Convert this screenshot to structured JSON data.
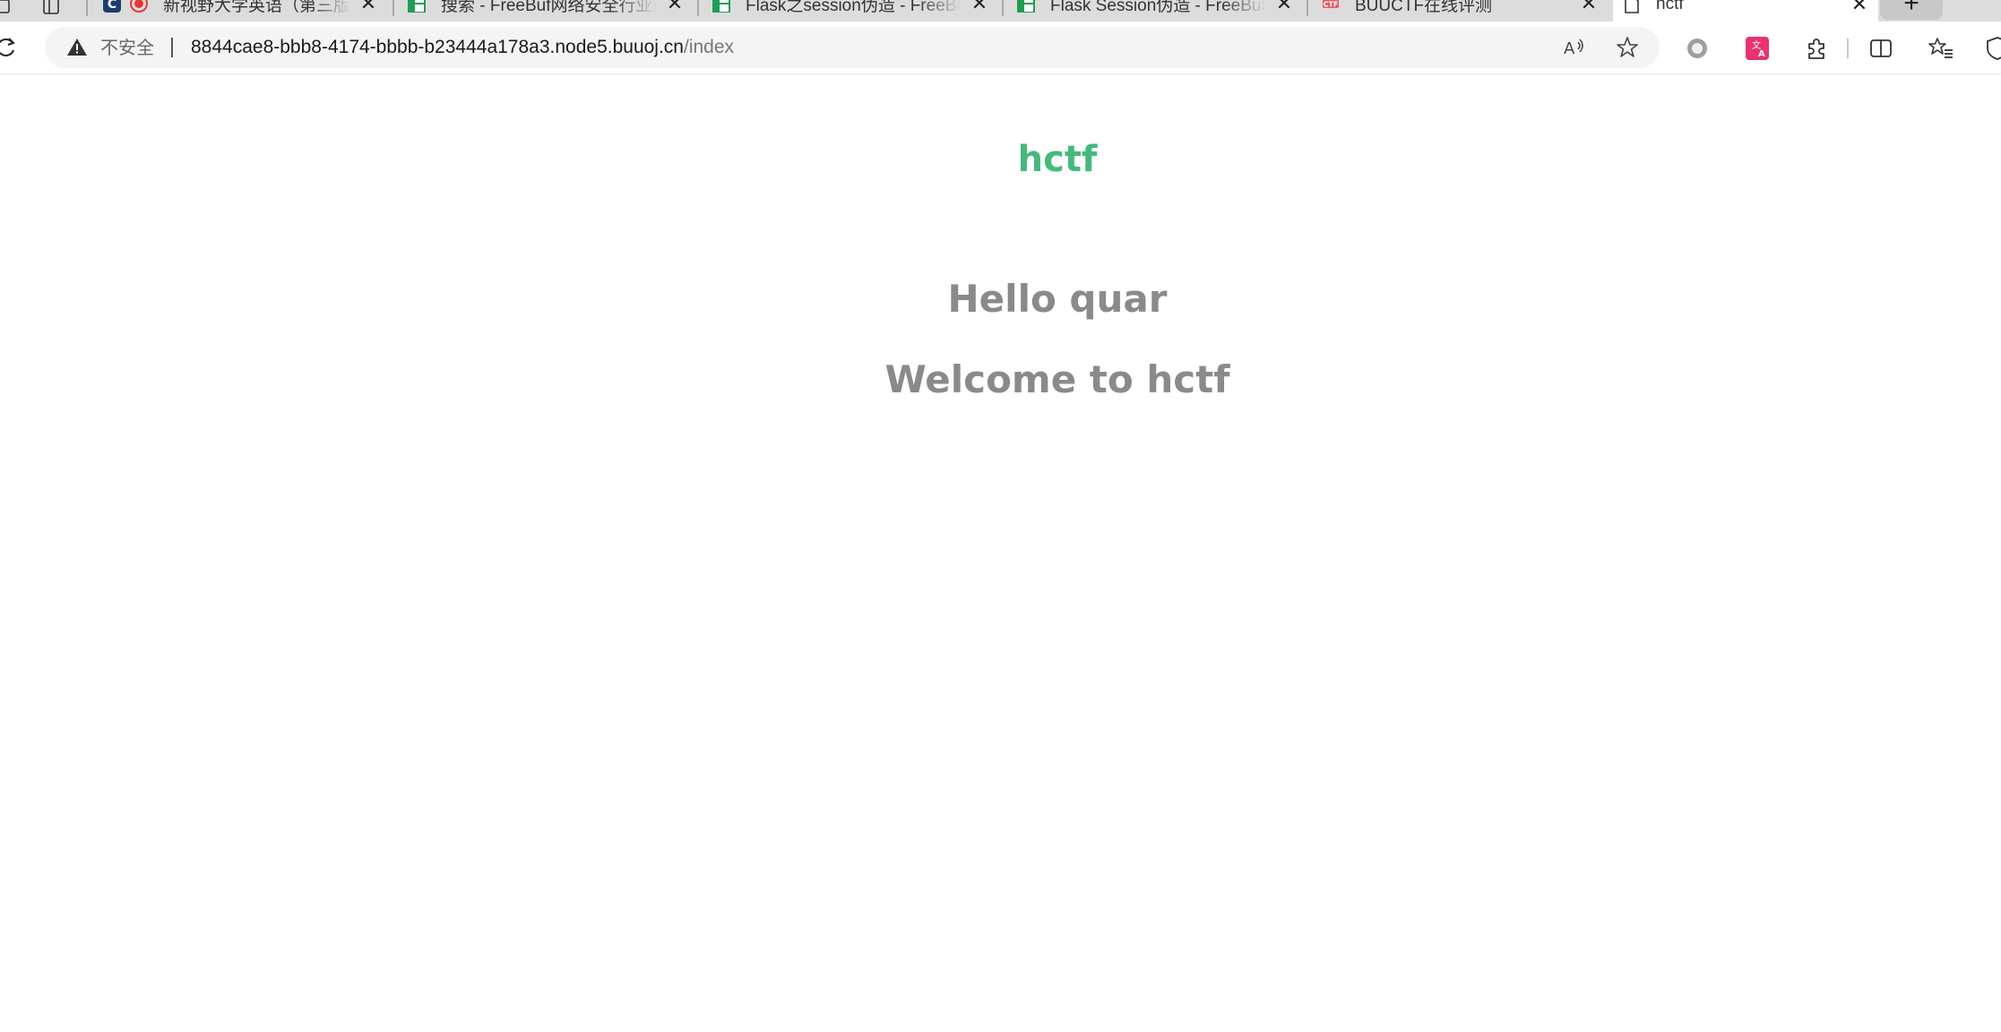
{
  "browser": {
    "tabs": [
      {
        "title": "新视野大学英语（第三版）",
        "favicon": "record-icon",
        "active": false
      },
      {
        "title": "搜索 - FreeBuf网络安全行业门户",
        "favicon": "freebuf-icon",
        "active": false
      },
      {
        "title": "Flask之session伪造 - FreeBuf网络安全",
        "favicon": "freebuf-icon",
        "active": false
      },
      {
        "title": "Flask Session伪造 - FreeBuf网络安全",
        "favicon": "freebuf-icon",
        "active": false
      },
      {
        "title": "BUUCTF在线评测",
        "favicon": "buuctf-icon",
        "active": false
      },
      {
        "title": "hctf",
        "favicon": "page-icon",
        "active": true
      }
    ],
    "newtab_label": "+",
    "close_glyph": "✕",
    "address": {
      "security_label": "不安全",
      "host": "8844cae8-bbb8-4174-bbbb-b23444a178a3.node5.buuoj.cn",
      "path": "/index"
    }
  },
  "page": {
    "brand": "hctf",
    "greeting": "Hello quar",
    "welcome": "Welcome to hctf"
  },
  "colors": {
    "brand": "#45b97c",
    "heading": "#8a8a8a"
  }
}
